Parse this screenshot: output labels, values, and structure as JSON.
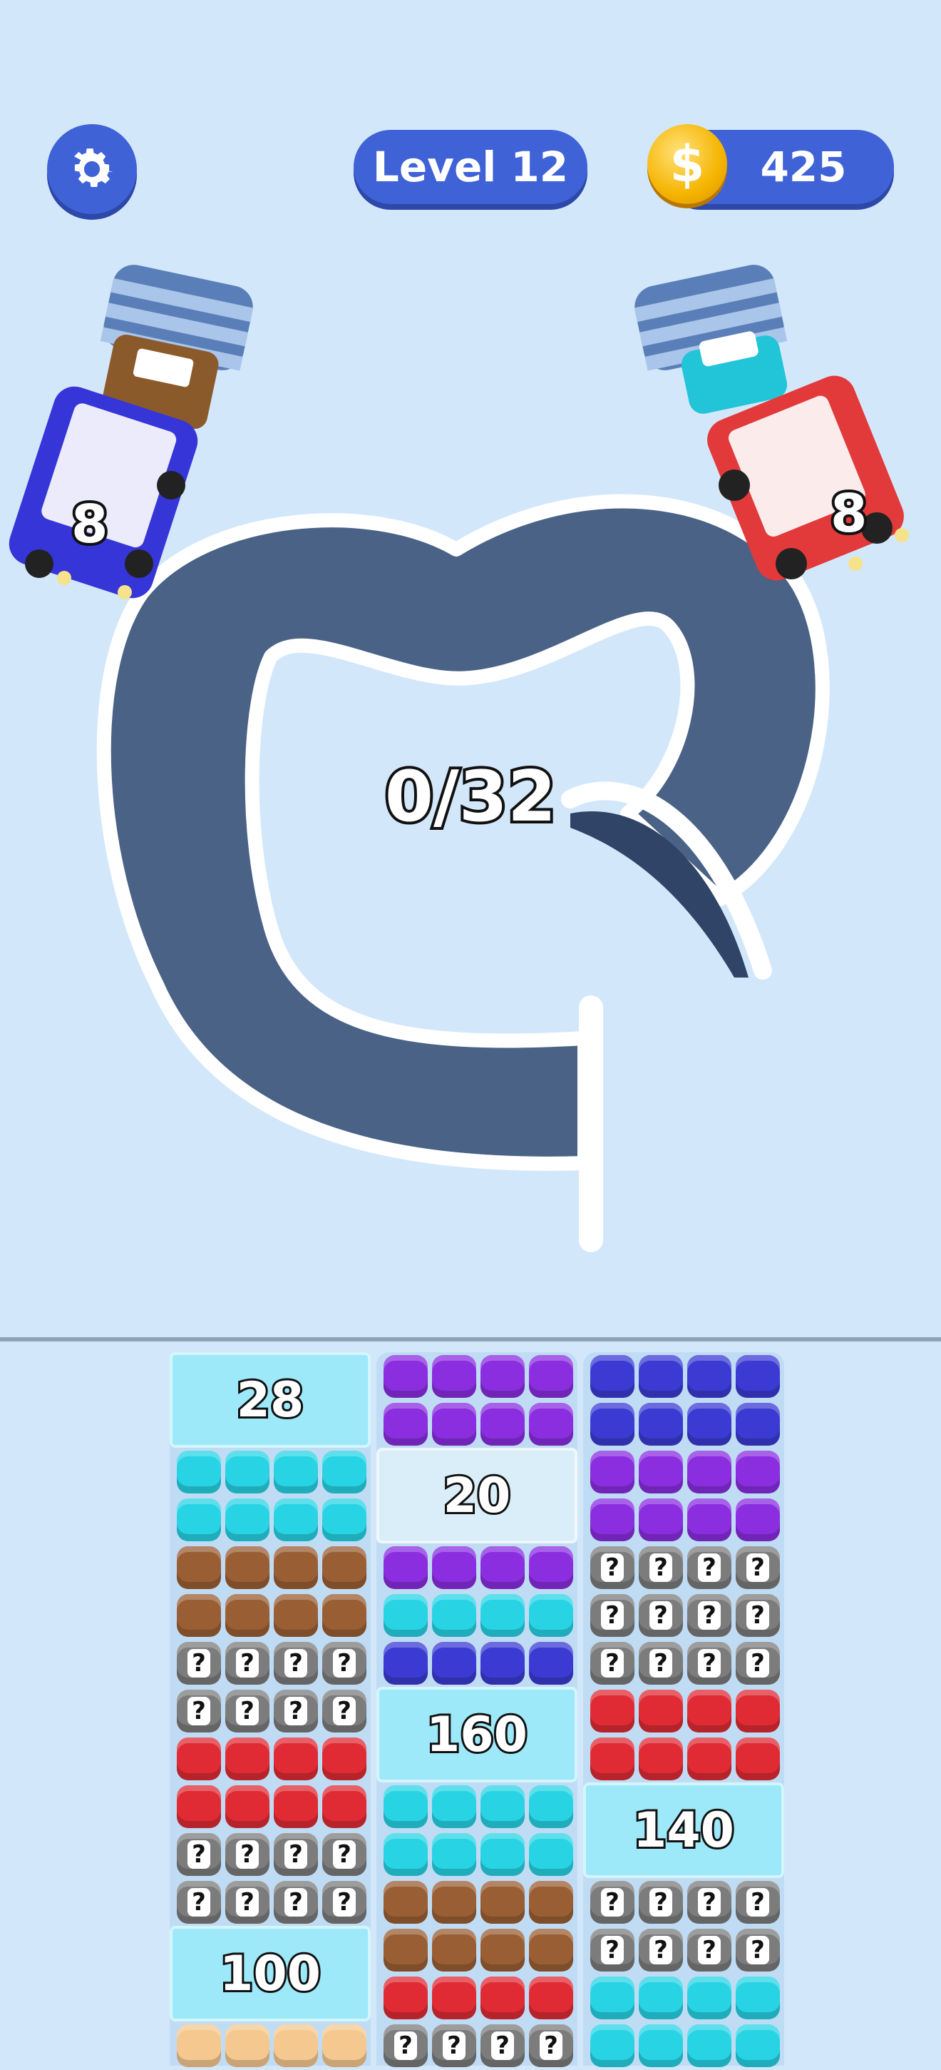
{
  "hud": {
    "level_label": "Level 12",
    "coins": "425",
    "coin_symbol": "$"
  },
  "board": {
    "progress": "0/32",
    "vehicles": [
      {
        "side": "left",
        "color": "#3535d8",
        "capacity": "8"
      },
      {
        "side": "right",
        "color": "#e23a3a",
        "capacity": "8"
      }
    ],
    "tunnels": [
      {
        "side": "left",
        "next_color": "#8b5a2b"
      },
      {
        "side": "right",
        "next_color": "#22c4d8"
      }
    ]
  },
  "tray": {
    "palette": {
      "cyan": "#28d4e4",
      "purple": "#8a2ee0",
      "blue": "#3b3bd4",
      "brown": "#9a5e34",
      "red": "#e02b34",
      "peach": "#f5c890",
      "hidden": "#7c7c7c"
    },
    "hidden_mark": "?",
    "columns": [
      {
        "rows": [
          "ice:28",
          "ice:28",
          "cyan",
          "cyan",
          "brown",
          "brown",
          "hidden",
          "hidden",
          "red",
          "red",
          "hidden",
          "hidden",
          "ice:100",
          "ice:100",
          "peach"
        ]
      },
      {
        "rows": [
          "purple",
          "purple",
          "ice:20",
          "ice:20",
          "purple",
          "cyan",
          "blue",
          "ice:160",
          "ice:160",
          "cyan",
          "cyan",
          "brown",
          "brown",
          "red",
          "hidden"
        ]
      },
      {
        "rows": [
          "blue",
          "blue",
          "purple",
          "purple",
          "hidden",
          "hidden",
          "hidden",
          "red",
          "red",
          "ice:140",
          "ice:140",
          "hidden",
          "hidden",
          "cyan",
          "cyan"
        ]
      }
    ],
    "ice_labels": [
      "28",
      "100",
      "20",
      "160",
      "140"
    ]
  }
}
